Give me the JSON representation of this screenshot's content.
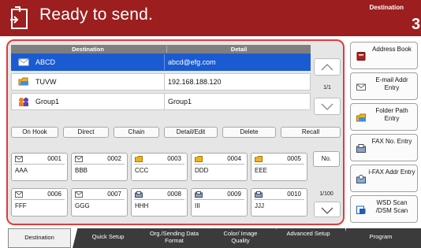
{
  "header": {
    "title": "Ready to send.",
    "destination_label": "Destination",
    "destination_count": "3"
  },
  "table": {
    "headers": [
      "Destination",
      "Detail"
    ],
    "rows": [
      {
        "name": "ABCD",
        "detail": "abcd@efg.com",
        "icon": "email-icon",
        "selected": true
      },
      {
        "name": "TUVW",
        "detail": "192.168.188.120",
        "icon": "folder-icon",
        "selected": false
      },
      {
        "name": "Group1",
        "detail": "Group1",
        "icon": "group-icon",
        "selected": false
      }
    ],
    "page": "1/1"
  },
  "actions": {
    "on_hook": "On Hook",
    "direct": "Direct",
    "chain": "Chain",
    "detail_edit": "Detail/Edit",
    "delete": "Delete",
    "recall": "Recall"
  },
  "one_touch": [
    {
      "num": "0001",
      "name": "AAA",
      "icon": "email-icon"
    },
    {
      "num": "0002",
      "name": "BBB",
      "icon": "email-icon"
    },
    {
      "num": "0003",
      "name": "CCC",
      "icon": "folder-icon"
    },
    {
      "num": "0004",
      "name": "DDD",
      "icon": "folder-icon"
    },
    {
      "num": "0005",
      "name": "EEE",
      "icon": "folder-icon"
    },
    {
      "num": "0006",
      "name": "FFF",
      "icon": "email-icon"
    },
    {
      "num": "0007",
      "name": "GGG",
      "icon": "email-icon"
    },
    {
      "num": "0008",
      "name": "HHH",
      "icon": "fax-icon"
    },
    {
      "num": "0009",
      "name": "III",
      "icon": "fax-icon"
    },
    {
      "num": "0010",
      "name": "JJJ",
      "icon": "fax-icon"
    }
  ],
  "one_touch_controls": {
    "no_label": "No.",
    "page": "1/100"
  },
  "side_buttons": [
    {
      "label": "Address Book",
      "icon": "address-book-icon"
    },
    {
      "label": "E-mail Addr Entry",
      "icon": "email-icon"
    },
    {
      "label": "Folder Path Entry",
      "icon": "folder-icon"
    },
    {
      "label": "FAX No. Entry",
      "icon": "fax-icon"
    },
    {
      "label": "i-FAX Addr Entry",
      "icon": "ifax-icon"
    },
    {
      "label": "WSD Scan /DSM Scan",
      "icon": "wsd-scan-icon"
    }
  ],
  "tabs": [
    "Destination",
    "Quick Setup",
    "Org./Sending Data Format",
    "Color/ Image Quality",
    "Advanced Setup",
    "Program"
  ],
  "colors": {
    "header": "#9c1e1e",
    "frame": "#e23b3b",
    "selected": "#1a5bd1",
    "tab": "#3b3b3b"
  }
}
